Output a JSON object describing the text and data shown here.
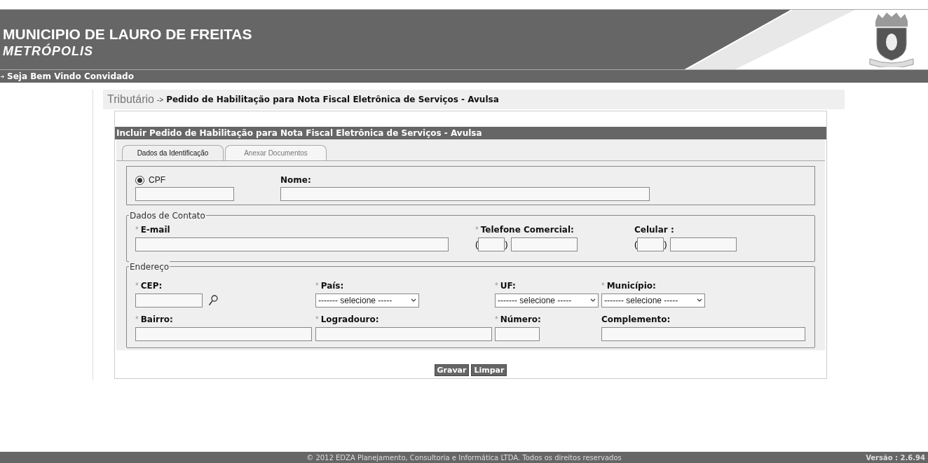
{
  "header": {
    "title": "MUNICIPIO DE LAURO DE FREITAS",
    "subtitle": "METRÓPOLIS",
    "welcome": "Seja Bem Vindo Convidado"
  },
  "breadcrumb": {
    "module": "Tributário",
    "separator": "->",
    "page": "Pedido de Habilitação para Nota Fiscal Eletrônica de Serviços - Avulsa"
  },
  "form_title": "Incluir Pedido de Habilitação para Nota Fiscal Eletrônica de Serviços - Avulsa",
  "tabs": [
    {
      "label": "Dados da Identificação",
      "selected": true
    },
    {
      "label": "Anexar Documentos",
      "selected": false
    }
  ],
  "identification": {
    "document": {
      "label": "CPF",
      "selected": true
    },
    "name_label": "Nome:"
  },
  "contact": {
    "legend": "Dados de Contato",
    "fields": [
      {
        "kind": "text",
        "mark": "*",
        "label": "E-mail"
      },
      {
        "kind": "phone",
        "mark": "*",
        "label": "Telefone Comercial:",
        "open": "(",
        "close": ")"
      },
      {
        "kind": "phone",
        "label": "Celular :",
        "open": "(",
        "close": ")"
      }
    ]
  },
  "address": {
    "legend": "Endereço",
    "fields": [
      {
        "kind": "cep",
        "mark": "*",
        "label": "CEP:"
      },
      {
        "kind": "select",
        "mark": "*",
        "label": "País:",
        "value": "------- selecione -----"
      },
      {
        "kind": "select",
        "mark": "*",
        "label": "UF:",
        "value": "------- selecione -----"
      },
      {
        "kind": "select",
        "mark": "*",
        "label": "Município:",
        "value": "------- selecione -----"
      },
      {
        "kind": "text",
        "mark": "*",
        "label": "Bairro:"
      },
      {
        "kind": "text",
        "mark": "*",
        "label": "Logradouro:"
      },
      {
        "kind": "short",
        "mark": "*",
        "label": "Número:"
      },
      {
        "kind": "text",
        "label": "Complemento:"
      }
    ]
  },
  "buttons": [
    "Gravar",
    "Limpar"
  ],
  "footer": {
    "copyright": "© 2012 EDZA Planejamento, Consultoria e Informática LTDA. Todos os direitos reservados",
    "version": "Versão : 2.6.94"
  }
}
